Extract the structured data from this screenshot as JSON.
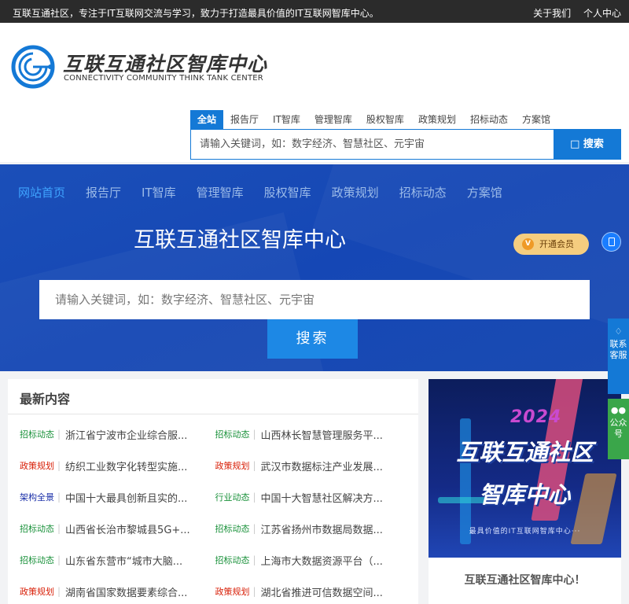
{
  "topbar": {
    "slogan": "互联互通社区，专注于IT互联网交流与学习，致力于打造最具价值的IT互联网智库中心。",
    "links": [
      "关于我们",
      "个人中心"
    ]
  },
  "logo": {
    "title": "互联互通社区智库中心",
    "subtitle": "CONNECTIVITY COMMUNITY THINK TANK CENTER"
  },
  "header_search": {
    "tabs": [
      "全站",
      "报告厅",
      "IT智库",
      "管理智库",
      "股权智库",
      "政策规划",
      "招标动态",
      "方案馆"
    ],
    "active_tab": "全站",
    "placeholder": "请输入关键词，如：数字经济、智慧社区、元宇宙",
    "button_label": "搜索"
  },
  "banner": {
    "nav": [
      "网站首页",
      "报告厅",
      "IT智库",
      "管理智库",
      "股权智库",
      "政策规划",
      "招标动态",
      "方案馆"
    ],
    "active_nav": "网站首页",
    "title": "互联互通社区智库中心",
    "vip_label": "开通会员",
    "search_placeholder": "请输入关键词，如：数字经济、智慧社区、元宇宙",
    "search_button": "搜索"
  },
  "side_buttons": {
    "service": "联系客服",
    "wechat": "公众号"
  },
  "latest": {
    "heading": "最新内容",
    "colors": {
      "招标动态": "#19913a",
      "政策规划": "#d81e06",
      "架构全景": "#1a2fa8",
      "行业动态": "#19913a"
    },
    "rows": [
      [
        {
          "tag": "招标动态",
          "title": "浙江省宁波市企业综合服..."
        },
        {
          "tag": "招标动态",
          "title": "山西林长智慧管理服务平..."
        }
      ],
      [
        {
          "tag": "政策规划",
          "title": "纺织工业数字化转型实施..."
        },
        {
          "tag": "政策规划",
          "title": "武汉市数据标注产业发展..."
        }
      ],
      [
        {
          "tag": "架构全景",
          "title": "中国十大最具创新且实的..."
        },
        {
          "tag": "行业动态",
          "title": "中国十大智慧社区解决方..."
        }
      ],
      [
        {
          "tag": "招标动态",
          "title": "山西省长治市黎城县5G+..."
        },
        {
          "tag": "招标动态",
          "title": "江苏省扬州市数据局数据..."
        }
      ],
      [
        {
          "tag": "招标动态",
          "title": "山东省东营市“城市大脑..."
        },
        {
          "tag": "招标动态",
          "title": "上海市大数据资源平台（..."
        }
      ],
      [
        {
          "tag": "政策规划",
          "title": "湖南省国家数据要素综合..."
        },
        {
          "tag": "政策规划",
          "title": "湖北省推进可信数据空间..."
        }
      ]
    ]
  },
  "promo": {
    "year": "2024",
    "line1": "互联互通社区",
    "line2": "智库中心",
    "small": "最具价值的IT互联网智库中心···",
    "caption": "互联互通社区智库中心！"
  }
}
